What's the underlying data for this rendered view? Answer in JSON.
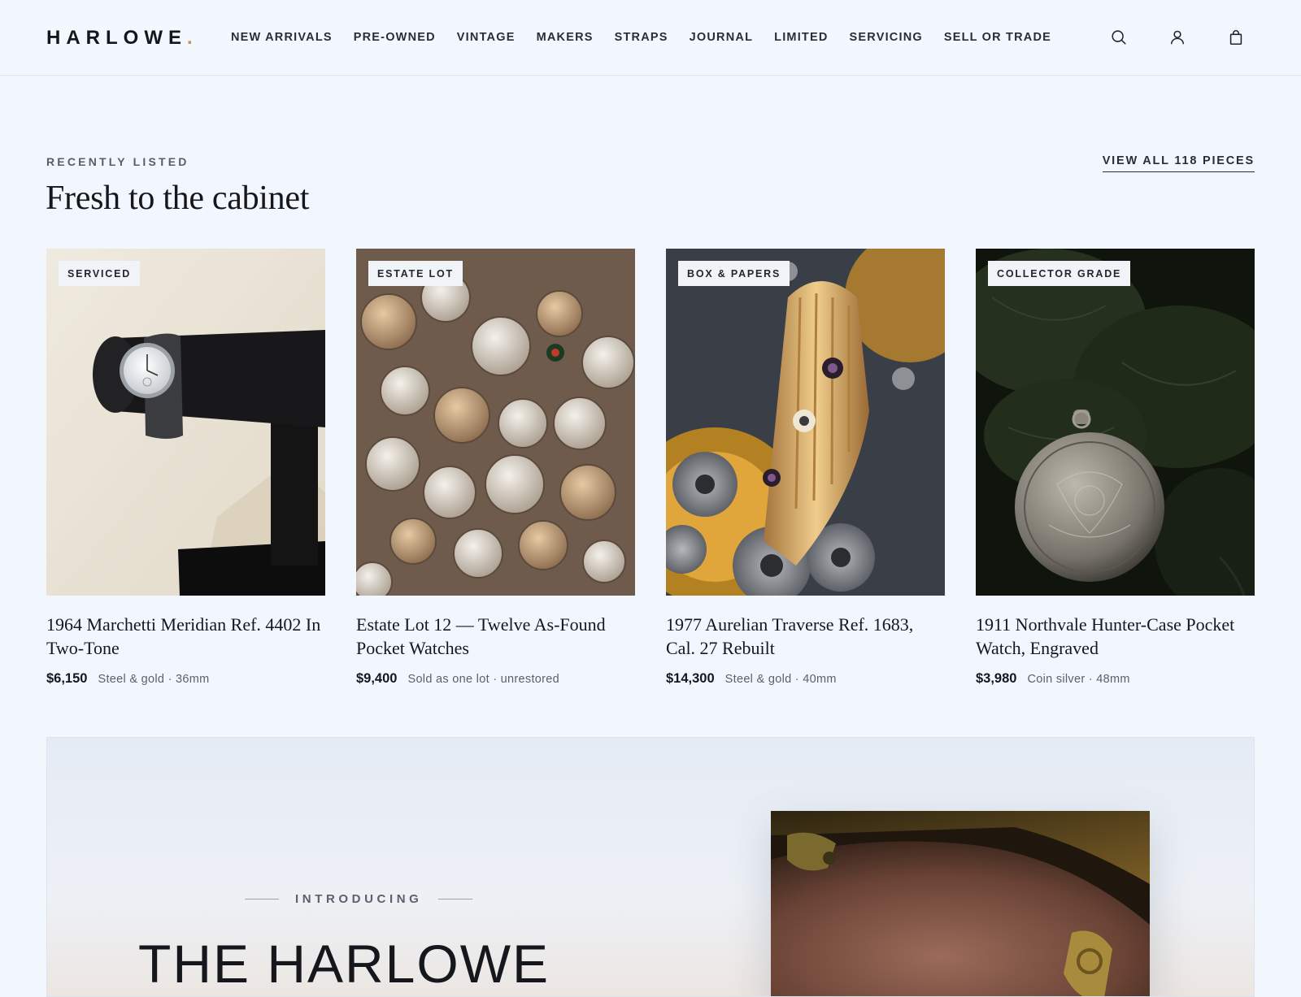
{
  "brand": {
    "name": "HARLOWE",
    "dot": ".",
    "accent_color": "#b89a4e"
  },
  "nav": {
    "items": [
      "NEW ARRIVALS",
      "PRE-OWNED",
      "VINTAGE",
      "MAKERS",
      "STRAPS",
      "JOURNAL",
      "LIMITED",
      "SERVICING",
      "SELL OR TRADE"
    ],
    "icons": [
      "search-icon",
      "account-icon",
      "bag-icon"
    ]
  },
  "section": {
    "eyebrow": "RECENTLY LISTED",
    "title": "Fresh to the cabinet",
    "view_all": "VIEW ALL 118 PIECES"
  },
  "products": [
    {
      "badge": "SERVICED",
      "title": "1964 Marchetti Meridian Ref. 4402 In Two-Tone",
      "price": "$6,150",
      "spec": "Steel & gold · 36mm"
    },
    {
      "badge": "ESTATE LOT",
      "title": "Estate Lot 12 — Twelve As-Found Pocket Watches",
      "price": "$9,400",
      "spec": "Sold as one lot · unrestored"
    },
    {
      "badge": "BOX & PAPERS",
      "title": "1977 Aurelian Traverse Ref. 1683, Cal. 27 Rebuilt",
      "price": "$14,300",
      "spec": "Steel & gold · 40mm"
    },
    {
      "badge": "COLLECTOR GRADE",
      "title": "1911 Northvale Hunter-Case Pocket Watch, Engraved",
      "price": "$3,980",
      "spec": "Coin silver · 48mm"
    }
  ],
  "feature": {
    "eyebrow": "INTRODUCING",
    "title": "THE HARLOWE"
  }
}
